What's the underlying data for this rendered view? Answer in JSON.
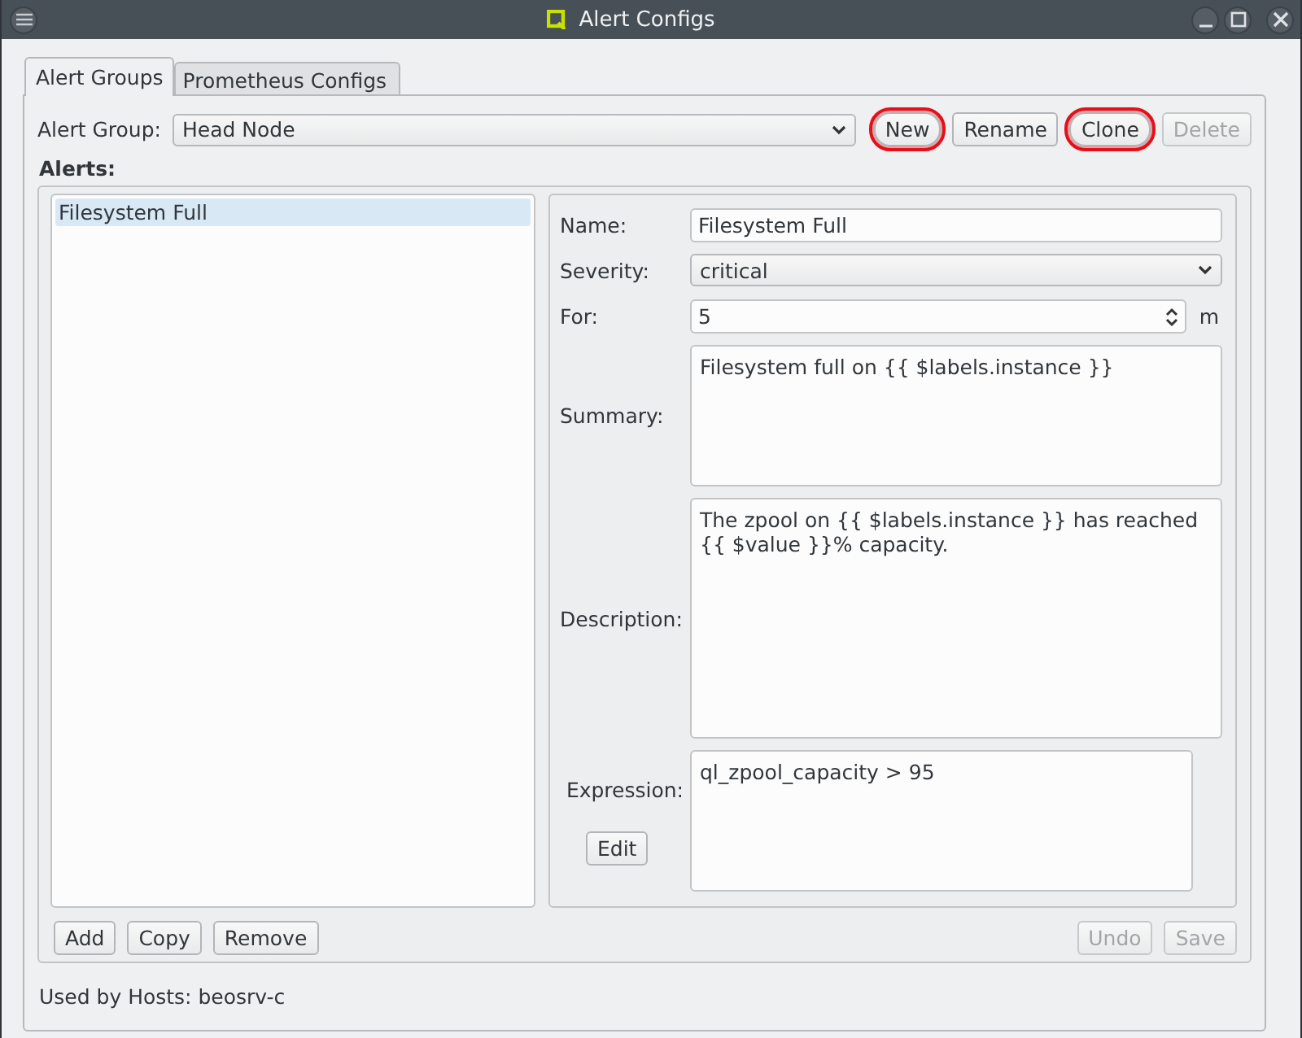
{
  "window": {
    "title": "Alert Configs"
  },
  "tabs": [
    {
      "label": "Alert Groups",
      "selected": true
    },
    {
      "label": "Prometheus Configs",
      "selected": false
    }
  ],
  "group": {
    "label": "Alert Group:",
    "value": "Head Node"
  },
  "group_buttons": [
    {
      "label": "New",
      "disabled": false,
      "highlighted": true
    },
    {
      "label": "Rename",
      "disabled": false,
      "highlighted": false
    },
    {
      "label": "Clone",
      "disabled": false,
      "highlighted": true
    },
    {
      "label": "Delete",
      "disabled": true,
      "highlighted": false
    }
  ],
  "alerts_label": "Alerts:",
  "alerts": [
    {
      "label": "Filesystem Full",
      "selected": true
    }
  ],
  "form": {
    "name_label": "Name:",
    "name": "Filesystem Full",
    "severity_label": "Severity:",
    "severity": "critical",
    "for_label": "For:",
    "for": "5",
    "for_unit": "m",
    "summary_label": "Summary:",
    "summary": "Filesystem full on {{ $labels.instance }}",
    "description_label": "Description:",
    "description": "The zpool on {{ $labels.instance }} has reached {{ $value }}% capacity.",
    "expression_label": "Expression:",
    "expression": "ql_zpool_capacity > 95",
    "edit_button": "Edit"
  },
  "list_buttons": [
    {
      "label": "Add",
      "disabled": false
    },
    {
      "label": "Copy",
      "disabled": false
    },
    {
      "label": "Remove",
      "disabled": false
    }
  ],
  "form_buttons": [
    {
      "label": "Undo",
      "disabled": true
    },
    {
      "label": "Save",
      "disabled": true
    }
  ],
  "status": "Used by Hosts: beosrv-c"
}
